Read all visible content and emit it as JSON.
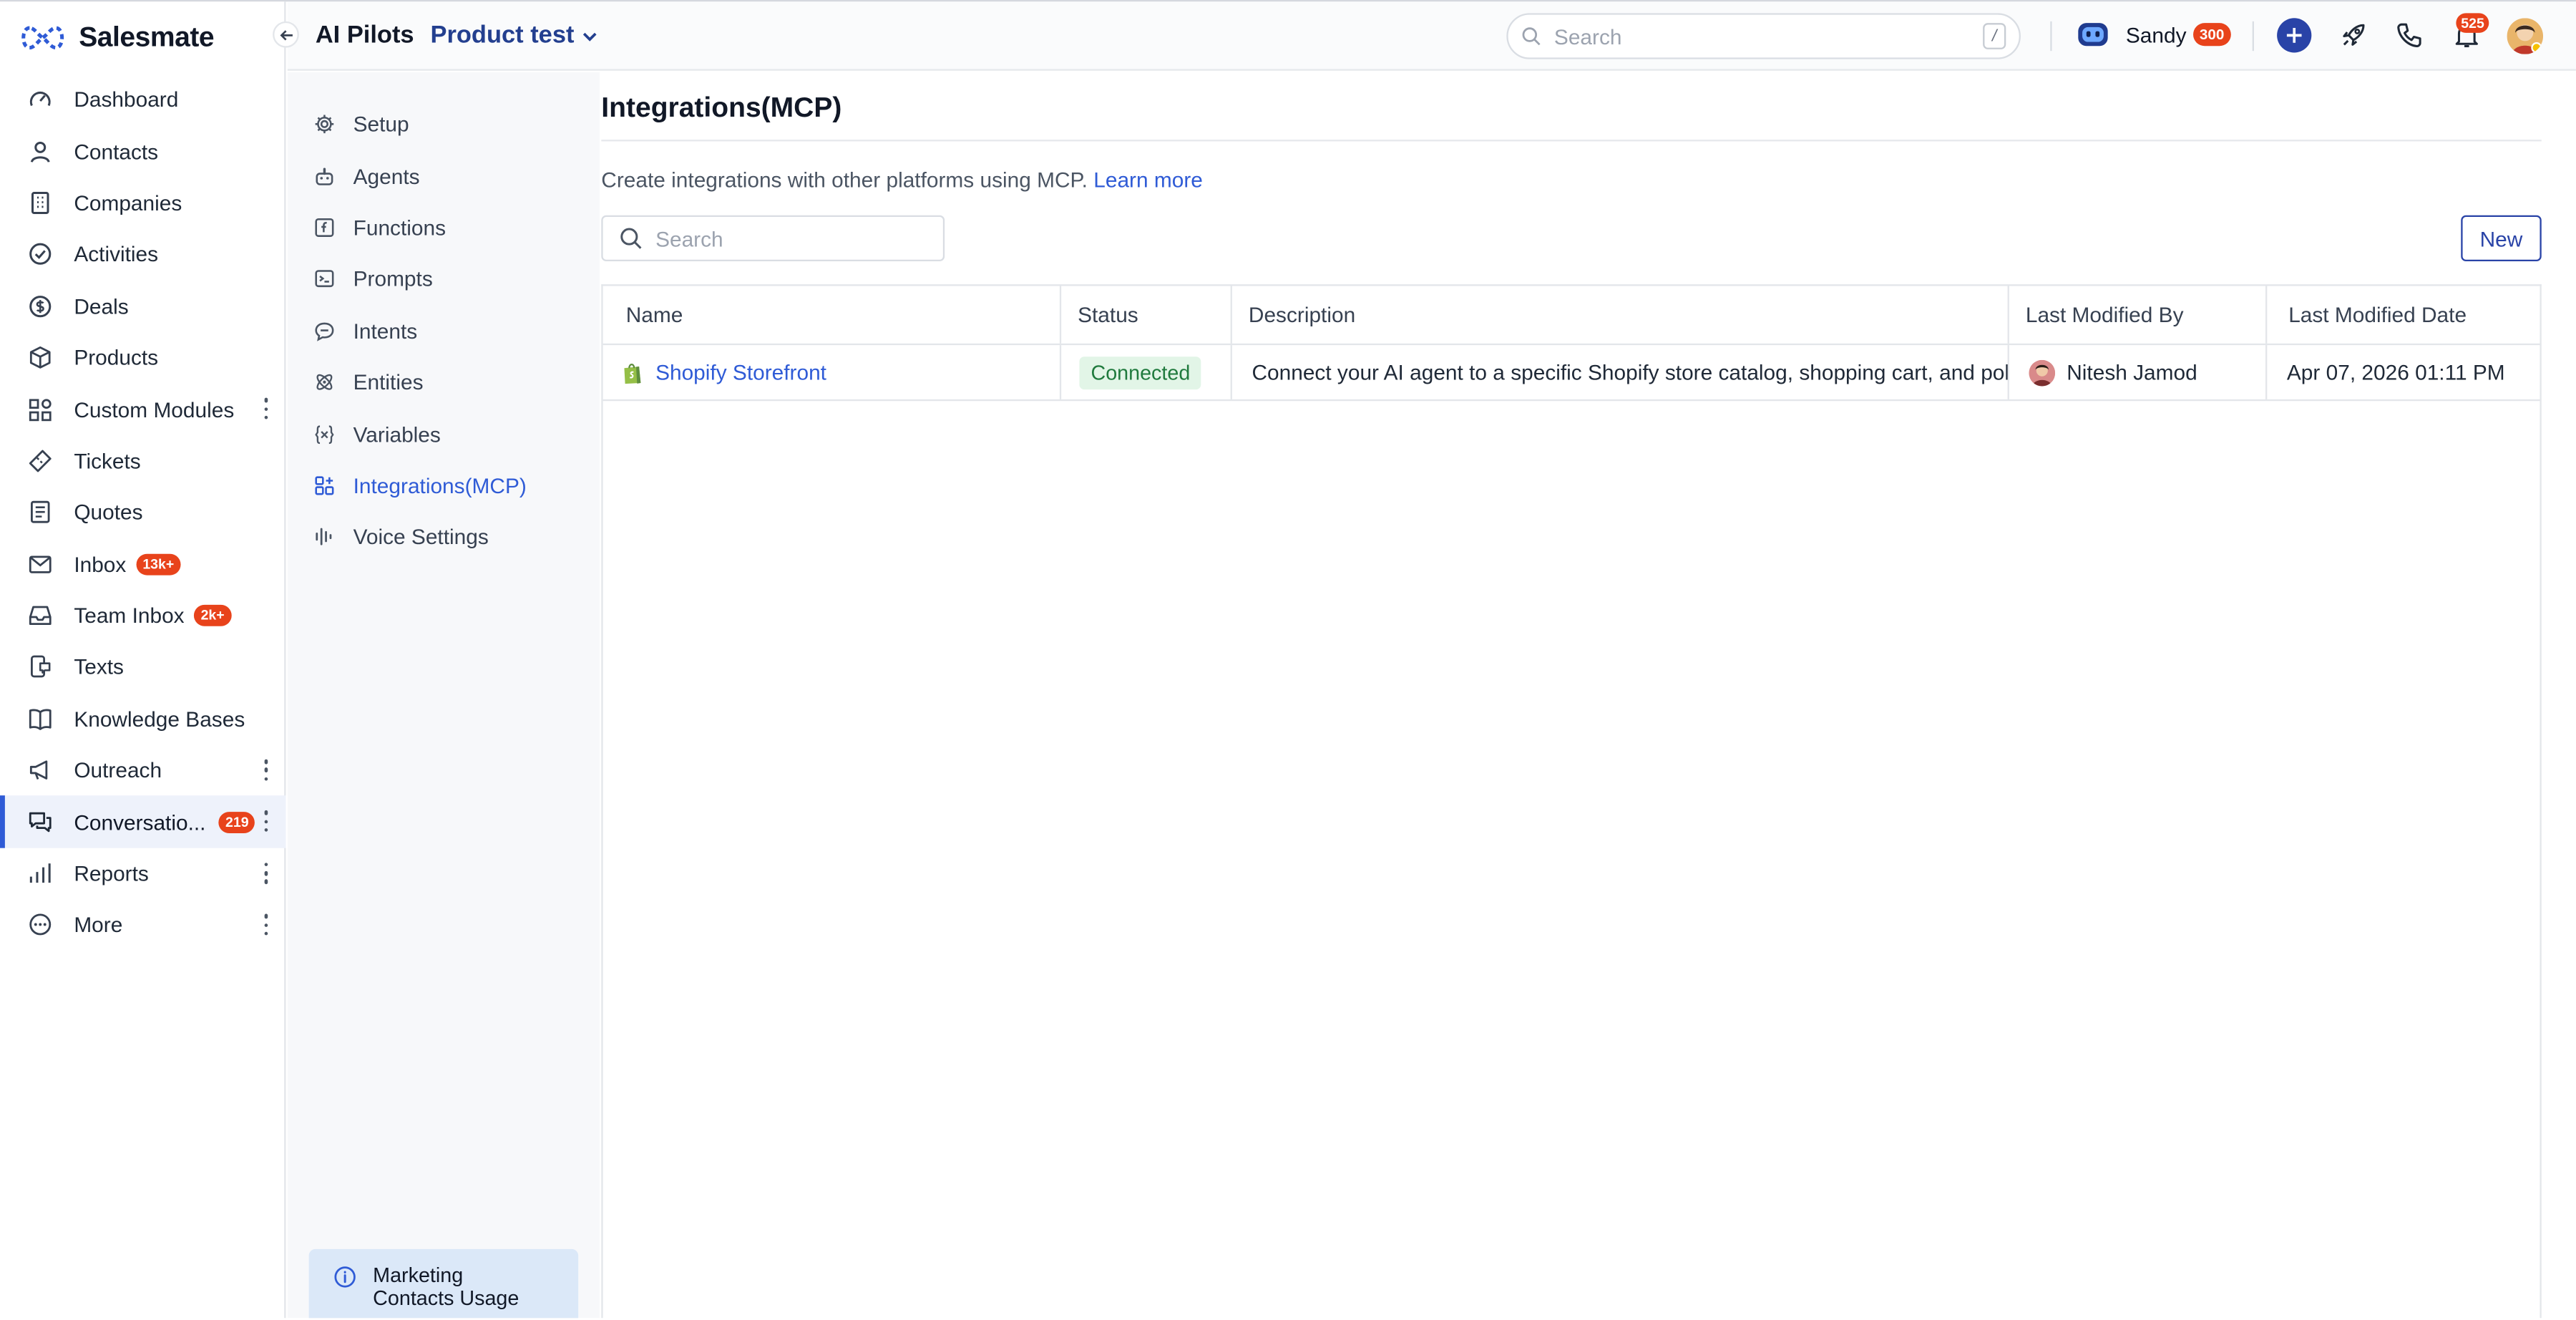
{
  "app": {
    "brand": "Salesmate"
  },
  "colors": {
    "accent": "#2f5bd6",
    "primary": "#2943a7",
    "badge": "#e8431b",
    "success_bg": "#e2f5e7",
    "success_text": "#1f7a3d"
  },
  "header": {
    "title": "AI Pilots",
    "project": "Product test",
    "search_placeholder": "Search",
    "search_shortcut": "/",
    "user_name": "Sandy",
    "user_badge": "300",
    "notification_count": "525"
  },
  "sidebar": {
    "items": [
      {
        "label": "Dashboard",
        "icon": "dashboard-icon"
      },
      {
        "label": "Contacts",
        "icon": "user-icon"
      },
      {
        "label": "Companies",
        "icon": "building-icon"
      },
      {
        "label": "Activities",
        "icon": "check-circle-icon"
      },
      {
        "label": "Deals",
        "icon": "dollar-icon"
      },
      {
        "label": "Products",
        "icon": "cube-icon"
      },
      {
        "label": "Custom Modules",
        "icon": "grid-icon"
      },
      {
        "label": "Tickets",
        "icon": "ticket-icon"
      },
      {
        "label": "Quotes",
        "icon": "document-icon"
      },
      {
        "label": "Inbox",
        "icon": "mail-icon",
        "badge": "13k+"
      },
      {
        "label": "Team Inbox",
        "icon": "inbox-icon",
        "badge": "2k+"
      },
      {
        "label": "Texts",
        "icon": "sms-icon"
      },
      {
        "label": "Knowledge Bases",
        "icon": "book-icon"
      },
      {
        "label": "Outreach",
        "icon": "megaphone-icon"
      },
      {
        "label": "Conversatio...",
        "icon": "chat-icon",
        "badge": "219",
        "active": true
      },
      {
        "label": "Reports",
        "icon": "bar-chart-icon"
      },
      {
        "label": "More",
        "icon": "more-circle-icon"
      }
    ]
  },
  "subnav": {
    "items": [
      {
        "label": "Setup",
        "icon": "gear-icon"
      },
      {
        "label": "Agents",
        "icon": "robot-icon"
      },
      {
        "label": "Functions",
        "icon": "function-icon"
      },
      {
        "label": "Prompts",
        "icon": "terminal-icon"
      },
      {
        "label": "Intents",
        "icon": "speech-bubble-icon"
      },
      {
        "label": "Entities",
        "icon": "atom-icon"
      },
      {
        "label": "Variables",
        "icon": "variable-icon"
      },
      {
        "label": "Integrations(MCP)",
        "icon": "integration-icon",
        "active": true
      },
      {
        "label": "Voice Settings",
        "icon": "waveform-icon"
      }
    ],
    "info_card": {
      "line1": "Marketing",
      "line2": "Contacts Usage"
    }
  },
  "main": {
    "title": "Integrations(MCP)",
    "description": "Create integrations with other platforms using MCP.",
    "learn_more": "Learn more",
    "search_placeholder": "Search",
    "new_button": "New",
    "table": {
      "columns": [
        "Name",
        "Status",
        "Description",
        "Last Modified By",
        "Last Modified Date"
      ],
      "rows": [
        {
          "name": "Shopify Storefront",
          "status": "Connected",
          "description": "Connect your AI agent to a specific Shopify store catalog, shopping cart, and policies",
          "modified_by": "Nitesh Jamod",
          "modified_date": "Apr 07, 2026 01:11 PM"
        }
      ]
    }
  }
}
